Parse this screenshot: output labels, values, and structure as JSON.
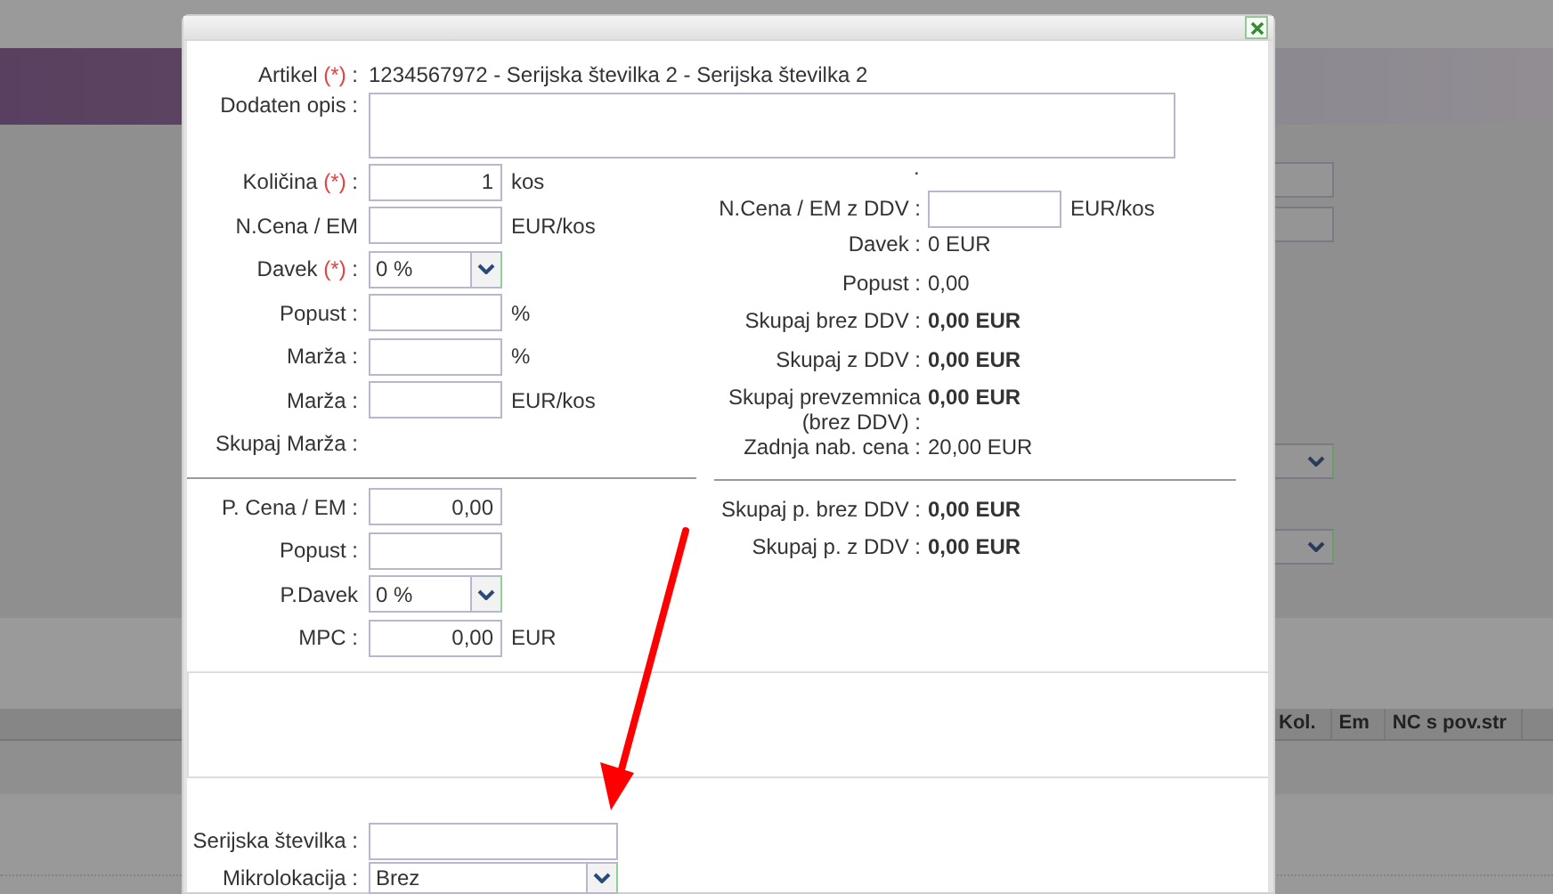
{
  "background": {
    "table_columns": [
      "Kol.",
      "Em",
      "NC s pov.str"
    ]
  },
  "dialog": {
    "article": {
      "label": "Artikel",
      "marker": "(*)",
      "suffix": ":",
      "value": "1234567972 - Serijska številka 2 - Serijska številka 2"
    },
    "description": {
      "label": "Dodaten opis",
      "suffix": ":"
    },
    "left_fields": [
      {
        "kind": "input",
        "label": "Količina",
        "marker": "(*)",
        "suffix": ":",
        "value": "1",
        "unit": "kos"
      },
      {
        "kind": "input",
        "label": "N.Cena / EM",
        "unit": "EUR/kos"
      },
      {
        "kind": "select",
        "label": "Davek",
        "marker": "(*)",
        "suffix": ":",
        "value": "0 %"
      },
      {
        "kind": "input",
        "label": "Popust",
        "suffix": ":",
        "unit": "%"
      },
      {
        "kind": "input",
        "label": "Marža",
        "suffix": ":",
        "unit": "%"
      },
      {
        "kind": "input",
        "label": "Marža",
        "suffix": ":",
        "unit": "EUR/kos"
      },
      {
        "kind": "text",
        "label": "Skupaj Marža",
        "suffix": ":"
      }
    ],
    "left_price_fields": [
      {
        "kind": "input",
        "label": "P. Cena / EM",
        "suffix": ":",
        "value": "0,00"
      },
      {
        "kind": "input",
        "label": "Popust",
        "suffix": ":"
      },
      {
        "kind": "select",
        "label": "P.Davek",
        "value": "0 %"
      },
      {
        "kind": "input",
        "label": "MPC",
        "suffix": ":",
        "value": "0,00",
        "unit": "EUR"
      }
    ],
    "right_marker": ".",
    "right_fields": [
      {
        "kind": "input",
        "label": "N.Cena / EM z DDV :",
        "unit": "EUR/kos"
      },
      {
        "kind": "text",
        "label": "Davek :",
        "value": "0 EUR",
        "bold": false
      },
      {
        "kind": "text",
        "label": "Popust :",
        "value": "0,00",
        "bold": false
      },
      {
        "kind": "text",
        "label": "Skupaj brez DDV :",
        "value": "0,00 EUR",
        "bold": true
      },
      {
        "kind": "text",
        "label": "Skupaj z DDV :",
        "value": "0,00 EUR",
        "bold": true
      },
      {
        "kind": "text",
        "label": "Skupaj prevzemnica (brez DDV) :",
        "value": "0,00 EUR",
        "bold": true
      },
      {
        "kind": "text",
        "label": "Zadnja nab. cena :",
        "value": "20,00 EUR",
        "bold": false
      }
    ],
    "right_total_fields": [
      {
        "kind": "text",
        "label": "Skupaj p. brez DDV :",
        "value": "0,00 EUR",
        "bold": true
      },
      {
        "kind": "text",
        "label": "Skupaj p. z DDV :",
        "value": "0,00 EUR",
        "bold": true
      }
    ],
    "bottom_fields": [
      {
        "kind": "input",
        "label": "Serijska številka",
        "suffix": ":"
      },
      {
        "kind": "select",
        "label": "Mikrolokacija",
        "suffix": ":",
        "value": "Brez"
      }
    ]
  }
}
